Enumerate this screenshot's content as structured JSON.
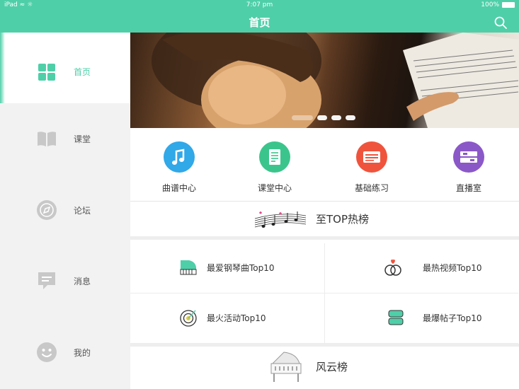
{
  "status_bar": {
    "device": "iPad",
    "time": "7:07 pm",
    "battery": "100%"
  },
  "nav": {
    "title": "首页"
  },
  "sidebar": {
    "items": [
      {
        "label": "首页",
        "icon": "grid-icon"
      },
      {
        "label": "课堂",
        "icon": "book-icon"
      },
      {
        "label": "论坛",
        "icon": "compass-icon"
      },
      {
        "label": "消息",
        "icon": "message-icon"
      },
      {
        "label": "我的",
        "icon": "smiley-icon"
      }
    ]
  },
  "quick_links": [
    {
      "label": "曲谱中心",
      "icon": "music-note-icon",
      "color": "#31a8e8"
    },
    {
      "label": "课堂中心",
      "icon": "document-icon",
      "color": "#3bc58c"
    },
    {
      "label": "基础练习",
      "icon": "card-icon",
      "color": "#f0533c"
    },
    {
      "label": "直播室",
      "icon": "broadcast-icon",
      "color": "#8b58c8"
    }
  ],
  "hot": {
    "title": "至TOP热榜",
    "cells": [
      {
        "label": "最爱钢琴曲Top10",
        "icon": "piano-icon"
      },
      {
        "label": "最热视频Top10",
        "icon": "rings-icon"
      },
      {
        "label": "最火活动Top10",
        "icon": "target-icon"
      },
      {
        "label": "最爆帖子Top10",
        "icon": "chat-icon"
      }
    ]
  },
  "wind": {
    "title": "风云榜",
    "icon": "grand-piano-icon"
  },
  "colors": {
    "accent": "#4fcfa8",
    "sidebar_bg": "#f2f2f2"
  }
}
